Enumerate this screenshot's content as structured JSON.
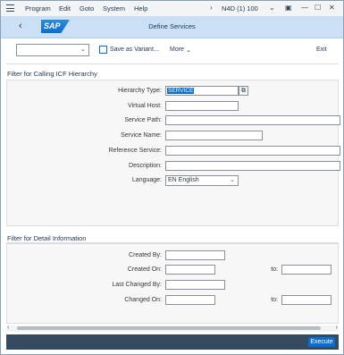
{
  "menubar": {
    "items": [
      "Program",
      "Edit",
      "Goto",
      "System",
      "Help"
    ],
    "system_id": "N4D (1) 100"
  },
  "titlebar": {
    "title": "Define Services",
    "logo": "SAP"
  },
  "toolbar": {
    "variant_placeholder": "",
    "save_variant": "Save as Variant...",
    "more": "More",
    "exit": "Exit"
  },
  "section1": {
    "title": "Filter for Calling ICF Hierarchy",
    "fields": {
      "hierarchy_type": {
        "label": "Hierarchy Type:",
        "value": "SERVICE"
      },
      "virtual_host": {
        "label": "Virtual Host:",
        "value": ""
      },
      "service_path": {
        "label": "Service Path:",
        "value": ""
      },
      "service_name": {
        "label": "Service Name:",
        "value": ""
      },
      "reference_service": {
        "label": "Reference Service:",
        "value": ""
      },
      "description": {
        "label": "Description:",
        "value": ""
      },
      "language": {
        "label": "Language:",
        "value": "EN English"
      }
    }
  },
  "section2": {
    "title": "Filter for Detail Information",
    "fields": {
      "created_by": {
        "label": "Created By:",
        "value": ""
      },
      "created_on": {
        "label": "Created On:",
        "value": "",
        "to_label": "to:",
        "to_value": ""
      },
      "last_changed_by": {
        "label": "Last Changed By:",
        "value": ""
      },
      "changed_on": {
        "label": "Changed On:",
        "value": "",
        "to_label": "to:",
        "to_value": ""
      }
    }
  },
  "footer": {
    "execute": "Execute"
  },
  "colors": {
    "titlebar": "#c9e0f5",
    "footer": "#354a5f",
    "accent": "#0a6ed1"
  }
}
